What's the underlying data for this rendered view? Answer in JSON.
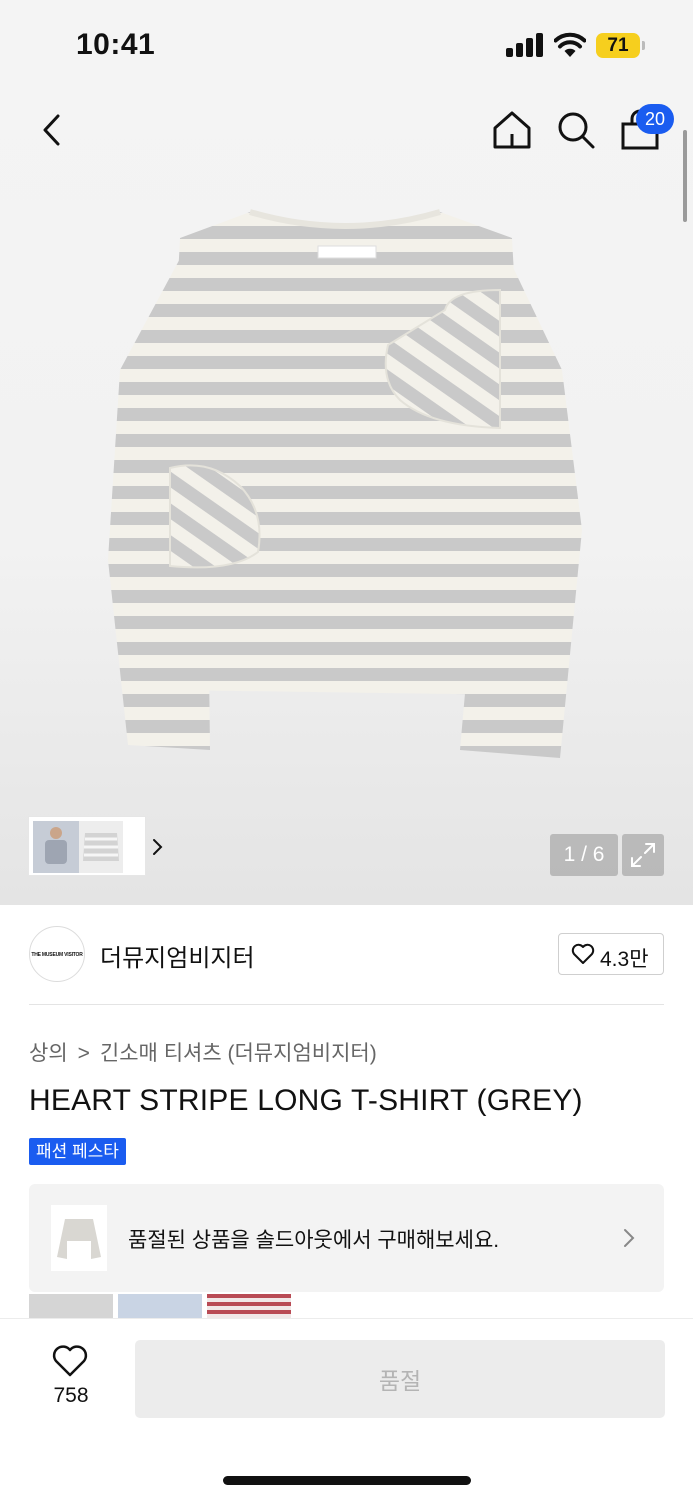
{
  "status_bar": {
    "time": "10:41",
    "battery": "71"
  },
  "nav": {
    "back_icon": "chevron-left-icon",
    "home_icon": "home-icon",
    "search_icon": "search-icon",
    "cart_icon": "shopping-bag-icon",
    "cart_count": "20"
  },
  "gallery": {
    "page_indicator": "1 / 6",
    "expand_icon": "expand-icon",
    "thumbnail_next_icon": "chevron-right-icon"
  },
  "seller": {
    "logo_text": "THE MUSEUM VISITOR",
    "name": "더뮤지엄비지터",
    "follow_count": "4.3만"
  },
  "breadcrumb": {
    "category": "상의",
    "subcategory": "긴소매 티셔츠 (더뮤지엄비지터)"
  },
  "product": {
    "title": "HEART STRIPE LONG T-SHIRT (GREY)",
    "event_badge": "패션 페스타"
  },
  "soldout_banner": {
    "text": "품절된 상품을 솔드아웃에서 구매해보세요."
  },
  "bottom_bar": {
    "like_count": "758",
    "buy_label": "품절"
  },
  "colors": {
    "accent": "#1a5cf0",
    "battery": "#f6cf1e",
    "stripe_grey": "#c9c9c9",
    "stripe_cream": "#f3f1ea"
  }
}
